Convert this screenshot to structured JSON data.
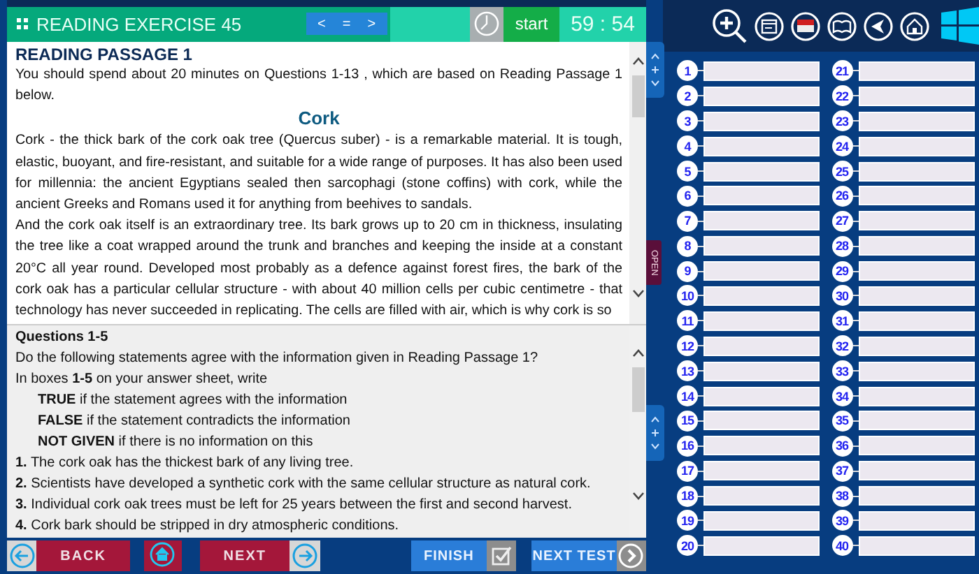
{
  "header": {
    "title": "READING EXERCISE 45",
    "nav": [
      "<",
      "=",
      ">"
    ],
    "start_label": "start",
    "timer": "59 : 54"
  },
  "passage": {
    "heading": "READING PASSAGE 1",
    "intro": "You should spend about 20 minutes on Questions 1-13 , which are based on Reading Passage 1 below.",
    "title": "Cork",
    "paragraphs": [
      "Cork - the thick bark of the cork oak tree (Quercus suber) - is a remarkable material. It is tough, elastic, buoyant, and fire-resistant, and suitable for a wide range of purposes. It has also been used for millennia: the ancient Egyptians sealed then sarcophagi (stone coffins) with cork, while the ancient Greeks and Romans used it for anything from beehives to sandals.",
      "And the cork oak itself is an extraordinary tree. Its bark grows up to 20 cm in thickness, insulating the tree like a coat wrapped around the trunk and branches and keeping the inside at a constant 20°C all year round. Developed most probably as a defence against forest fires, the bark of the cork oak has a particular cellular structure - with about 40 million cells per cubic centimetre - that technology has never succeeded in replicating. The cells are filled with air, which is why cork is so"
    ]
  },
  "questions": {
    "heading": "Questions 1-5",
    "lines": [
      {
        "kind": "plain",
        "text": "Do the following statements agree with the information given in Reading Passage 1?"
      },
      {
        "kind": "plain",
        "text": "In boxes **1-5** on your answer sheet, write"
      },
      {
        "kind": "option",
        "text": "**TRUE** if the statement agrees with the information"
      },
      {
        "kind": "option",
        "text": "**FALSE** if the statement contradicts the information"
      },
      {
        "kind": "option",
        "text": "**NOT GIVEN** if there is no information on this"
      },
      {
        "kind": "plain",
        "text": "**1.** The cork oak has the thickest bark of any living tree."
      },
      {
        "kind": "plain",
        "text": "**2.** Scientists have developed a synthetic cork with the same cellular structure as natural cork."
      },
      {
        "kind": "plain",
        "text": "**3.** Individual cork oak trees must be left for 25 years between the first and second harvest."
      },
      {
        "kind": "plain",
        "text": "**4.** Cork bark should be stripped in dry atmospheric conditions."
      }
    ]
  },
  "side_tab": {
    "label": "OPEN"
  },
  "buttons": {
    "back": "BACK",
    "next": "NEXT",
    "finish": "FINISH",
    "next_test": "NEXT TEST"
  },
  "answers": [
    "1",
    "2",
    "3",
    "4",
    "5",
    "6",
    "7",
    "8",
    "9",
    "10",
    "11",
    "12",
    "13",
    "14",
    "15",
    "16",
    "17",
    "18",
    "19",
    "20",
    "21",
    "22",
    "23",
    "24",
    "25",
    "26",
    "27",
    "28",
    "29",
    "30",
    "31",
    "32",
    "33",
    "34",
    "35",
    "36",
    "37",
    "38",
    "39",
    "40"
  ]
}
